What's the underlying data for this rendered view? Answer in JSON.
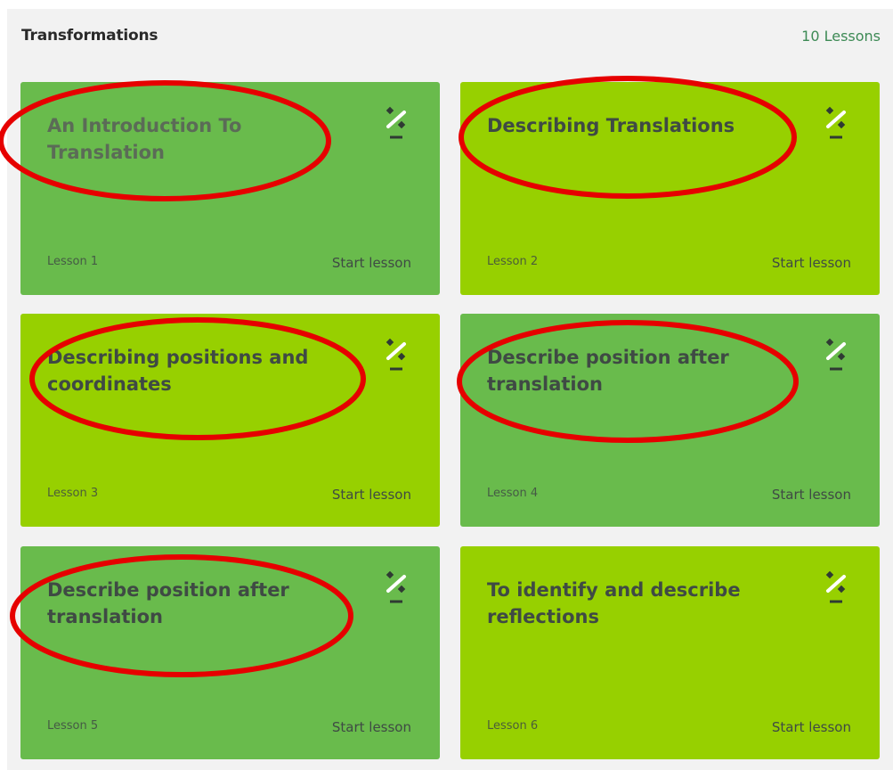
{
  "section": {
    "title": "Transformations",
    "count_label": "10 Lessons"
  },
  "lessons": [
    {
      "title": "An Introduction To Translation",
      "number_label": "Lesson 1",
      "action_label": "Start lesson",
      "color": "#69bb4c"
    },
    {
      "title": "Describing Translations",
      "number_label": "Lesson 2",
      "action_label": "Start lesson",
      "color": "#97d000"
    },
    {
      "title": "Describing positions and coordinates",
      "number_label": "Lesson 3",
      "action_label": "Start lesson",
      "color": "#97d000"
    },
    {
      "title": "Describe position after translation",
      "number_label": "Lesson 4",
      "action_label": "Start lesson",
      "color": "#69bb4c"
    },
    {
      "title": "Describe position after translation",
      "number_label": "Lesson 5",
      "action_label": "Start lesson",
      "color": "#69bb4c"
    },
    {
      "title": "To identify and describe reflections",
      "number_label": "Lesson 6",
      "action_label": "Start lesson",
      "color": "#97d000"
    }
  ],
  "icons": {
    "card_icon": "percent-icon"
  },
  "colors": {
    "annotation_ring": "#e60000",
    "accent_text": "#3d8a55"
  }
}
